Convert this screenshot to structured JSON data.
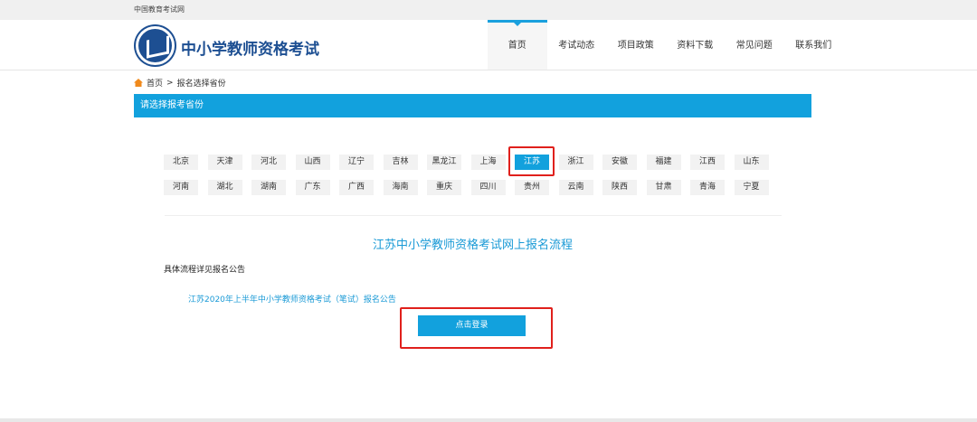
{
  "topbar": {
    "site": "中国教育考试网"
  },
  "header": {
    "title": "中小学教师资格考试",
    "nav": [
      "首页",
      "考试动态",
      "项目政策",
      "资料下载",
      "常见问题",
      "联系我们"
    ]
  },
  "breadcrumb": {
    "home": "首页",
    "sep": ">",
    "current": "报名选择省份"
  },
  "section_title": "请选择报考省份",
  "provinces_row1": [
    "北京",
    "天津",
    "河北",
    "山西",
    "辽宁",
    "吉林",
    "黑龙江",
    "上海",
    "江苏",
    "浙江",
    "安徽",
    "福建",
    "江西",
    "山东"
  ],
  "provinces_row2": [
    "河南",
    "湖北",
    "湖南",
    "广东",
    "广西",
    "海南",
    "重庆",
    "四川",
    "贵州",
    "云南",
    "陕西",
    "甘肃",
    "青海",
    "宁夏"
  ],
  "selected_province": "江苏",
  "content": {
    "heading": "江苏中小学教师资格考试网上报名流程",
    "note": "具体流程详见报名公告",
    "link": "江苏2020年上半年中小学教师资格考试（笔试）报名公告",
    "login_button": "点击登录"
  },
  "colors": {
    "accent": "#12a1dd",
    "highlight": "#e0201c",
    "brand": "#1d4f92"
  }
}
